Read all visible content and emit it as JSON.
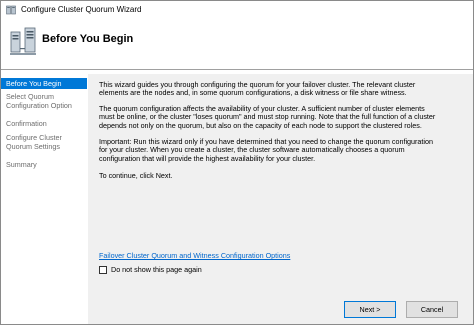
{
  "window": {
    "title": "Configure Cluster Quorum Wizard"
  },
  "header": {
    "title": "Before You Begin"
  },
  "nav": {
    "items": [
      {
        "label": "Before You Begin",
        "active": true
      },
      {
        "label": "Select Quorum\nConfiguration Option",
        "active": false
      },
      {
        "label": "Confirmation",
        "active": false
      },
      {
        "label": "Configure Cluster\nQuorum Settings",
        "active": false
      },
      {
        "label": "Summary",
        "active": false
      }
    ]
  },
  "content": {
    "para1": "This wizard guides you through configuring the quorum for your failover cluster. The relevant cluster\nelements are the nodes and, in some quorum configurations, a disk witness or file share witness.",
    "para2": "The quorum configuration affects the availability of your cluster. A sufficient number of cluster elements\nmust be online, or the cluster \"loses quorum\" and must stop running. Note that the full function of a cluster\ndepends not only on the quorum, but also on the capacity of each node to support the clustered roles.",
    "para3": "Important:  Run this wizard only if you have determined that you need to change the quorum configuration\nfor your cluster. When you create a cluster, the cluster software automatically chooses a quorum\nconfiguration that will provide the highest availability for your cluster.",
    "para4": "To continue, click Next.",
    "link": "Failover Cluster Quorum and Witness Configuration Options",
    "checkbox_label": "Do not show this page again",
    "checkbox_checked": false
  },
  "footer": {
    "next_label": "Next >",
    "cancel_label": "Cancel"
  },
  "colors": {
    "accent": "#0078d7",
    "panel": "#f0f0f0",
    "link": "#0066cc"
  },
  "icons": {
    "title": "cluster-icon",
    "header": "cluster-server-icon"
  }
}
